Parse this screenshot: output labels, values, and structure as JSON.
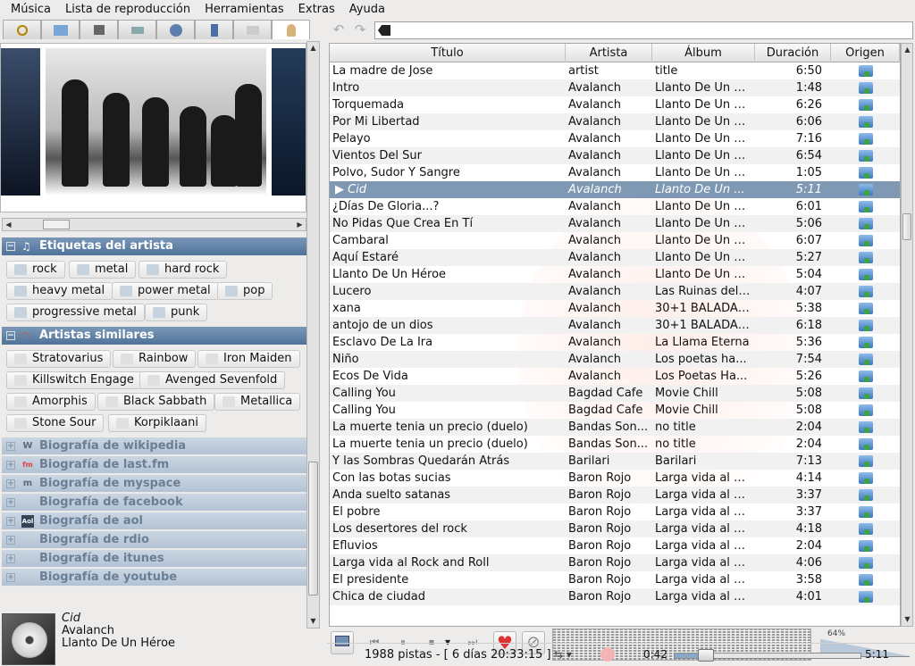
{
  "menu": [
    "Música",
    "Lista de reproducción",
    "Herramientas",
    "Extras",
    "Ayuda"
  ],
  "left_tabs": [
    "search-icon",
    "music-library-icon",
    "files-icon",
    "radio-icon",
    "globe-icon",
    "device-icon",
    "playlist-icon",
    "artist-info-icon"
  ],
  "tags_header": "Etiquetas del artista",
  "tags": [
    "rock",
    "metal",
    "hard rock",
    "heavy metal",
    "power metal",
    "pop",
    "progressive metal",
    "punk"
  ],
  "similar_header": "Artistas similares",
  "similar": [
    "Stratovarius",
    "Rainbow",
    "Iron Maiden",
    "Killswitch Engage",
    "Avenged Sevenfold",
    "Amorphis",
    "Black Sabbath",
    "Metallica",
    "Stone Sour",
    "Korpiklaani"
  ],
  "bios": [
    {
      "label": "Biografía de wikipedia",
      "icon": "W"
    },
    {
      "label": "Biografía de last.fm",
      "icon": "fm"
    },
    {
      "label": "Biografía de myspace",
      "icon": "m"
    },
    {
      "label": "Biografía de facebook",
      "icon": ""
    },
    {
      "label": "Biografía de aol",
      "icon": "Aol"
    },
    {
      "label": "Biografía de rdio",
      "icon": ""
    },
    {
      "label": "Biografía de itunes",
      "icon": ""
    },
    {
      "label": "Biografía de youtube",
      "icon": ""
    }
  ],
  "now_playing": {
    "title": "Cid",
    "artist": "Avalanch",
    "album": "Llanto De Un Héroe"
  },
  "columns": [
    "Título",
    "Artista",
    "Álbum",
    "Duración",
    "Origen"
  ],
  "rows": [
    [
      "La madre de Jose",
      "artist",
      "title",
      "6:50"
    ],
    [
      "Intro",
      "Avalanch",
      "Llanto De Un H...",
      "1:48"
    ],
    [
      "Torquemada",
      "Avalanch",
      "Llanto De Un H...",
      "6:26"
    ],
    [
      "Por Mi Libertad",
      "Avalanch",
      "Llanto De Un H...",
      "6:06"
    ],
    [
      "Pelayo",
      "Avalanch",
      "Llanto De Un H...",
      "7:16"
    ],
    [
      "Vientos Del Sur",
      "Avalanch",
      "Llanto De Un H...",
      "6:54"
    ],
    [
      "Polvo, Sudor Y Sangre",
      "Avalanch",
      "Llanto De Un H...",
      "1:05"
    ],
    [
      "Cid",
      "Avalanch",
      "Llanto De Un ...",
      "5:11"
    ],
    [
      "¿Días De Gloria...?",
      "Avalanch",
      "Llanto De Un H...",
      "6:01"
    ],
    [
      "No Pidas Que Crea En Tí",
      "Avalanch",
      "Llanto De Un H...",
      "5:06"
    ],
    [
      "Cambaral",
      "Avalanch",
      "Llanto De Un H...",
      "6:07"
    ],
    [
      "Aquí Estaré",
      "Avalanch",
      "Llanto De Un H...",
      "5:27"
    ],
    [
      "Llanto De Un Héroe",
      "Avalanch",
      "Llanto De Un H...",
      "5:04"
    ],
    [
      "Lucero",
      "Avalanch",
      "Las Ruinas del ...",
      "4:07"
    ],
    [
      "xana",
      "Avalanch",
      "30+1 BALADAS...",
      "5:38"
    ],
    [
      "antojo de un dios",
      "Avalanch",
      "30+1 BALADAS...",
      "6:18"
    ],
    [
      "Esclavo De La Ira",
      "Avalanch",
      "La Llama Eterna",
      "5:36"
    ],
    [
      "Niño",
      "Avalanch",
      "Los poetas ha...",
      "7:54"
    ],
    [
      "Ecos De Vida",
      "Avalanch",
      "Los Poetas Ha...",
      "5:26"
    ],
    [
      "Calling You",
      "Bagdad Cafe",
      "Movie Chill",
      "5:08"
    ],
    [
      "Calling You",
      "Bagdad Cafe",
      "Movie Chill",
      "5:08"
    ],
    [
      "La muerte tenia un precio (duelo)",
      "Bandas Son...",
      "no title",
      "2:04"
    ],
    [
      "La muerte tenia un precio (duelo)",
      "Bandas Son...",
      "no title",
      "2:04"
    ],
    [
      "Y las Sombras Quedarán Atrás",
      "Barilari",
      "Barilari",
      "7:13"
    ],
    [
      "Con las botas sucias",
      "Baron Rojo",
      "Larga vida al R...",
      "4:14"
    ],
    [
      "Anda suelto satanas",
      "Baron Rojo",
      "Larga vida al R...",
      "3:37"
    ],
    [
      "El pobre",
      "Baron Rojo",
      "Larga vida al R...",
      "3:37"
    ],
    [
      "Los desertores del rock",
      "Baron Rojo",
      "Larga vida al R...",
      "4:18"
    ],
    [
      "Efluvios",
      "Baron Rojo",
      "Larga vida al R...",
      "2:04"
    ],
    [
      "Larga vida al Rock and Roll",
      "Baron Rojo",
      "Larga vida al R...",
      "4:06"
    ],
    [
      "El presidente",
      "Baron Rojo",
      "Larga vida al R...",
      "3:58"
    ],
    [
      "Chica de ciudad",
      "Baron Rojo",
      "Larga vida al R...",
      "4:01"
    ]
  ],
  "selected_row": 7,
  "volume": "64%",
  "status": "1988 pistas - [ 6 días 20:33:15 ]",
  "elapsed": "0:42",
  "total": "5:11",
  "seek_fraction": 0.135
}
